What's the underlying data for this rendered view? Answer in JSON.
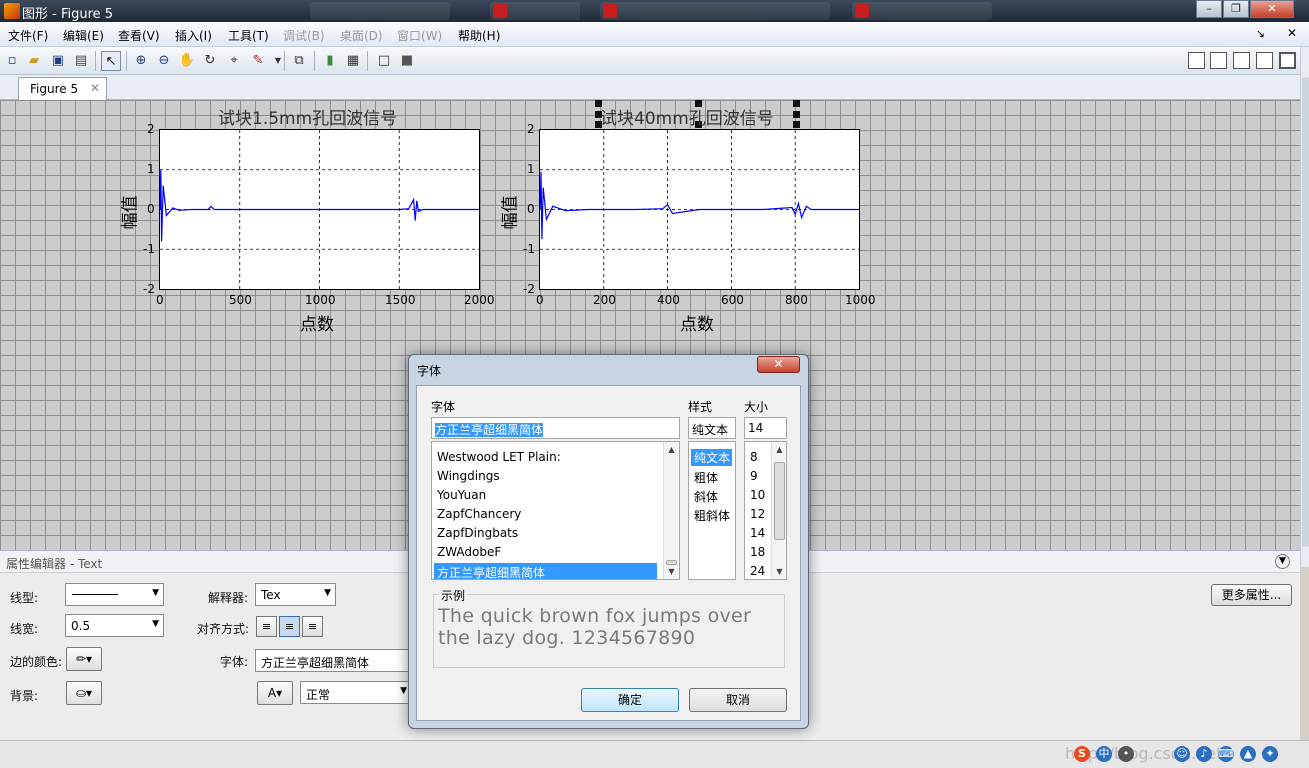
{
  "window": {
    "title": "图形 - Figure 5",
    "controls": {
      "minimize": "–",
      "maximize": "❐",
      "close": "✕"
    }
  },
  "menubar": {
    "items": [
      {
        "label": "文件(F)",
        "enabled": true
      },
      {
        "label": "编辑(E)",
        "enabled": true
      },
      {
        "label": "查看(V)",
        "enabled": true
      },
      {
        "label": "插入(I)",
        "enabled": true
      },
      {
        "label": "工具(T)",
        "enabled": true
      },
      {
        "label": "调试(B)",
        "enabled": false
      },
      {
        "label": "桌面(D)",
        "enabled": false
      },
      {
        "label": "窗口(W)",
        "enabled": false
      },
      {
        "label": "帮助(H)",
        "enabled": true
      }
    ],
    "dock_arrow": "↘",
    "close": "✕"
  },
  "toolbar": {
    "icons": [
      "new-file-icon",
      "open-folder-icon",
      "save-icon",
      "print-icon",
      "edit-plot-arrow-icon",
      "zoom-in-icon",
      "zoom-out-icon",
      "pan-hand-icon",
      "rotate-3d-icon",
      "data-cursor-icon",
      "brush-icon",
      "link-plot-icon",
      "colorbar-icon",
      "legend-icon",
      "hide-plot-tools-icon",
      "show-plot-tools-icon"
    ],
    "layout_icons": [
      "tile-grid-icon",
      "tile-columns-icon",
      "tile-rows-icon",
      "float-icon",
      "maximize-icon"
    ]
  },
  "figure_tab": {
    "label": "Figure 5",
    "close": "✕"
  },
  "plots": [
    {
      "title": "试块1.5mm孔回波信号",
      "ylabel": "幅值",
      "xlabel": "点数",
      "xticks": [
        "0",
        "500",
        "1000",
        "1500",
        "2000"
      ],
      "yticks": [
        "2",
        "1",
        "0",
        "-1",
        "-2"
      ]
    },
    {
      "title": "试块40mm孔回波信号",
      "ylabel": "幅值",
      "xlabel": "点数",
      "xticks": [
        "0",
        "200",
        "400",
        "600",
        "800",
        "1000"
      ],
      "yticks": [
        "2",
        "1",
        "0",
        "-1",
        "-2"
      ]
    }
  ],
  "chart_data": [
    {
      "type": "line",
      "title": "试块1.5mm孔回波信号",
      "xlabel": "点数",
      "ylabel": "幅值",
      "xlim": [
        0,
        2000
      ],
      "ylim": [
        -2,
        2
      ],
      "grid": true,
      "series_color": "#0000ff",
      "x": [
        0,
        5,
        10,
        20,
        40,
        80,
        120,
        200,
        300,
        320,
        340,
        500,
        800,
        1000,
        1200,
        1500,
        1560,
        1590,
        1600,
        1610,
        1620,
        1650,
        1800,
        2000
      ],
      "y": [
        0.0,
        1.0,
        -0.8,
        0.6,
        -0.15,
        0.04,
        -0.02,
        0.0,
        0.0,
        0.08,
        0.0,
        0.0,
        0.0,
        0.0,
        0.0,
        0.0,
        0.02,
        0.25,
        -0.28,
        0.22,
        -0.05,
        0.0,
        0.0,
        0.0
      ]
    },
    {
      "type": "line",
      "title": "试块40mm孔回波信号",
      "xlabel": "点数",
      "ylabel": "幅值",
      "xlim": [
        0,
        1000
      ],
      "ylim": [
        -2,
        2
      ],
      "grid": true,
      "series_color": "#0000ff",
      "x": [
        0,
        3,
        6,
        10,
        20,
        40,
        80,
        150,
        300,
        385,
        400,
        415,
        500,
        700,
        790,
        800,
        810,
        820,
        835,
        850,
        1000
      ],
      "y": [
        0.0,
        0.95,
        -0.75,
        0.55,
        -0.25,
        0.08,
        -0.03,
        0.0,
        0.0,
        0.02,
        0.12,
        -0.1,
        0.0,
        0.0,
        0.05,
        -0.12,
        0.15,
        -0.2,
        0.08,
        0.0,
        0.0
      ]
    }
  ],
  "property_editor": {
    "header": "属性编辑器 - Text",
    "line_style_label": "线型:",
    "line_width_label": "线宽:",
    "line_width_value": "0.5",
    "edge_color_label": "边的颜色:",
    "background_label": "背景:",
    "interpreter_label": "解释器:",
    "interpreter_value": "Tex",
    "alignment_label": "对齐方式:",
    "font_label": "字体:",
    "font_value": "方正兰亭超细黑简体",
    "font_style_value": "正常",
    "more_properties": "更多属性..."
  },
  "font_dialog": {
    "title": "字体",
    "font_label": "字体",
    "style_label": "样式",
    "size_label": "大小",
    "font_input": "方正兰亭超细黑简体",
    "style_input": "纯文本",
    "size_input": "14",
    "fonts": [
      "Westwood LET Plain:",
      "Wingdings",
      "YouYuan",
      "ZapfChancery",
      "ZapfDingbats",
      "ZWAdobeF",
      "方正兰亭超细黑简体"
    ],
    "selected_font": "方正兰亭超细黑简体",
    "styles": [
      "纯文本",
      "粗体",
      "斜体",
      "粗斜体"
    ],
    "sizes": [
      "8",
      "9",
      "10",
      "12",
      "14",
      "18",
      "24"
    ],
    "sample_label": "示例",
    "sample_text": "The quick brown fox jumps over the lazy dog.  1234567890",
    "ok": "确定",
    "cancel": "取消"
  },
  "watermark": "http://blog.csdn.net/"
}
